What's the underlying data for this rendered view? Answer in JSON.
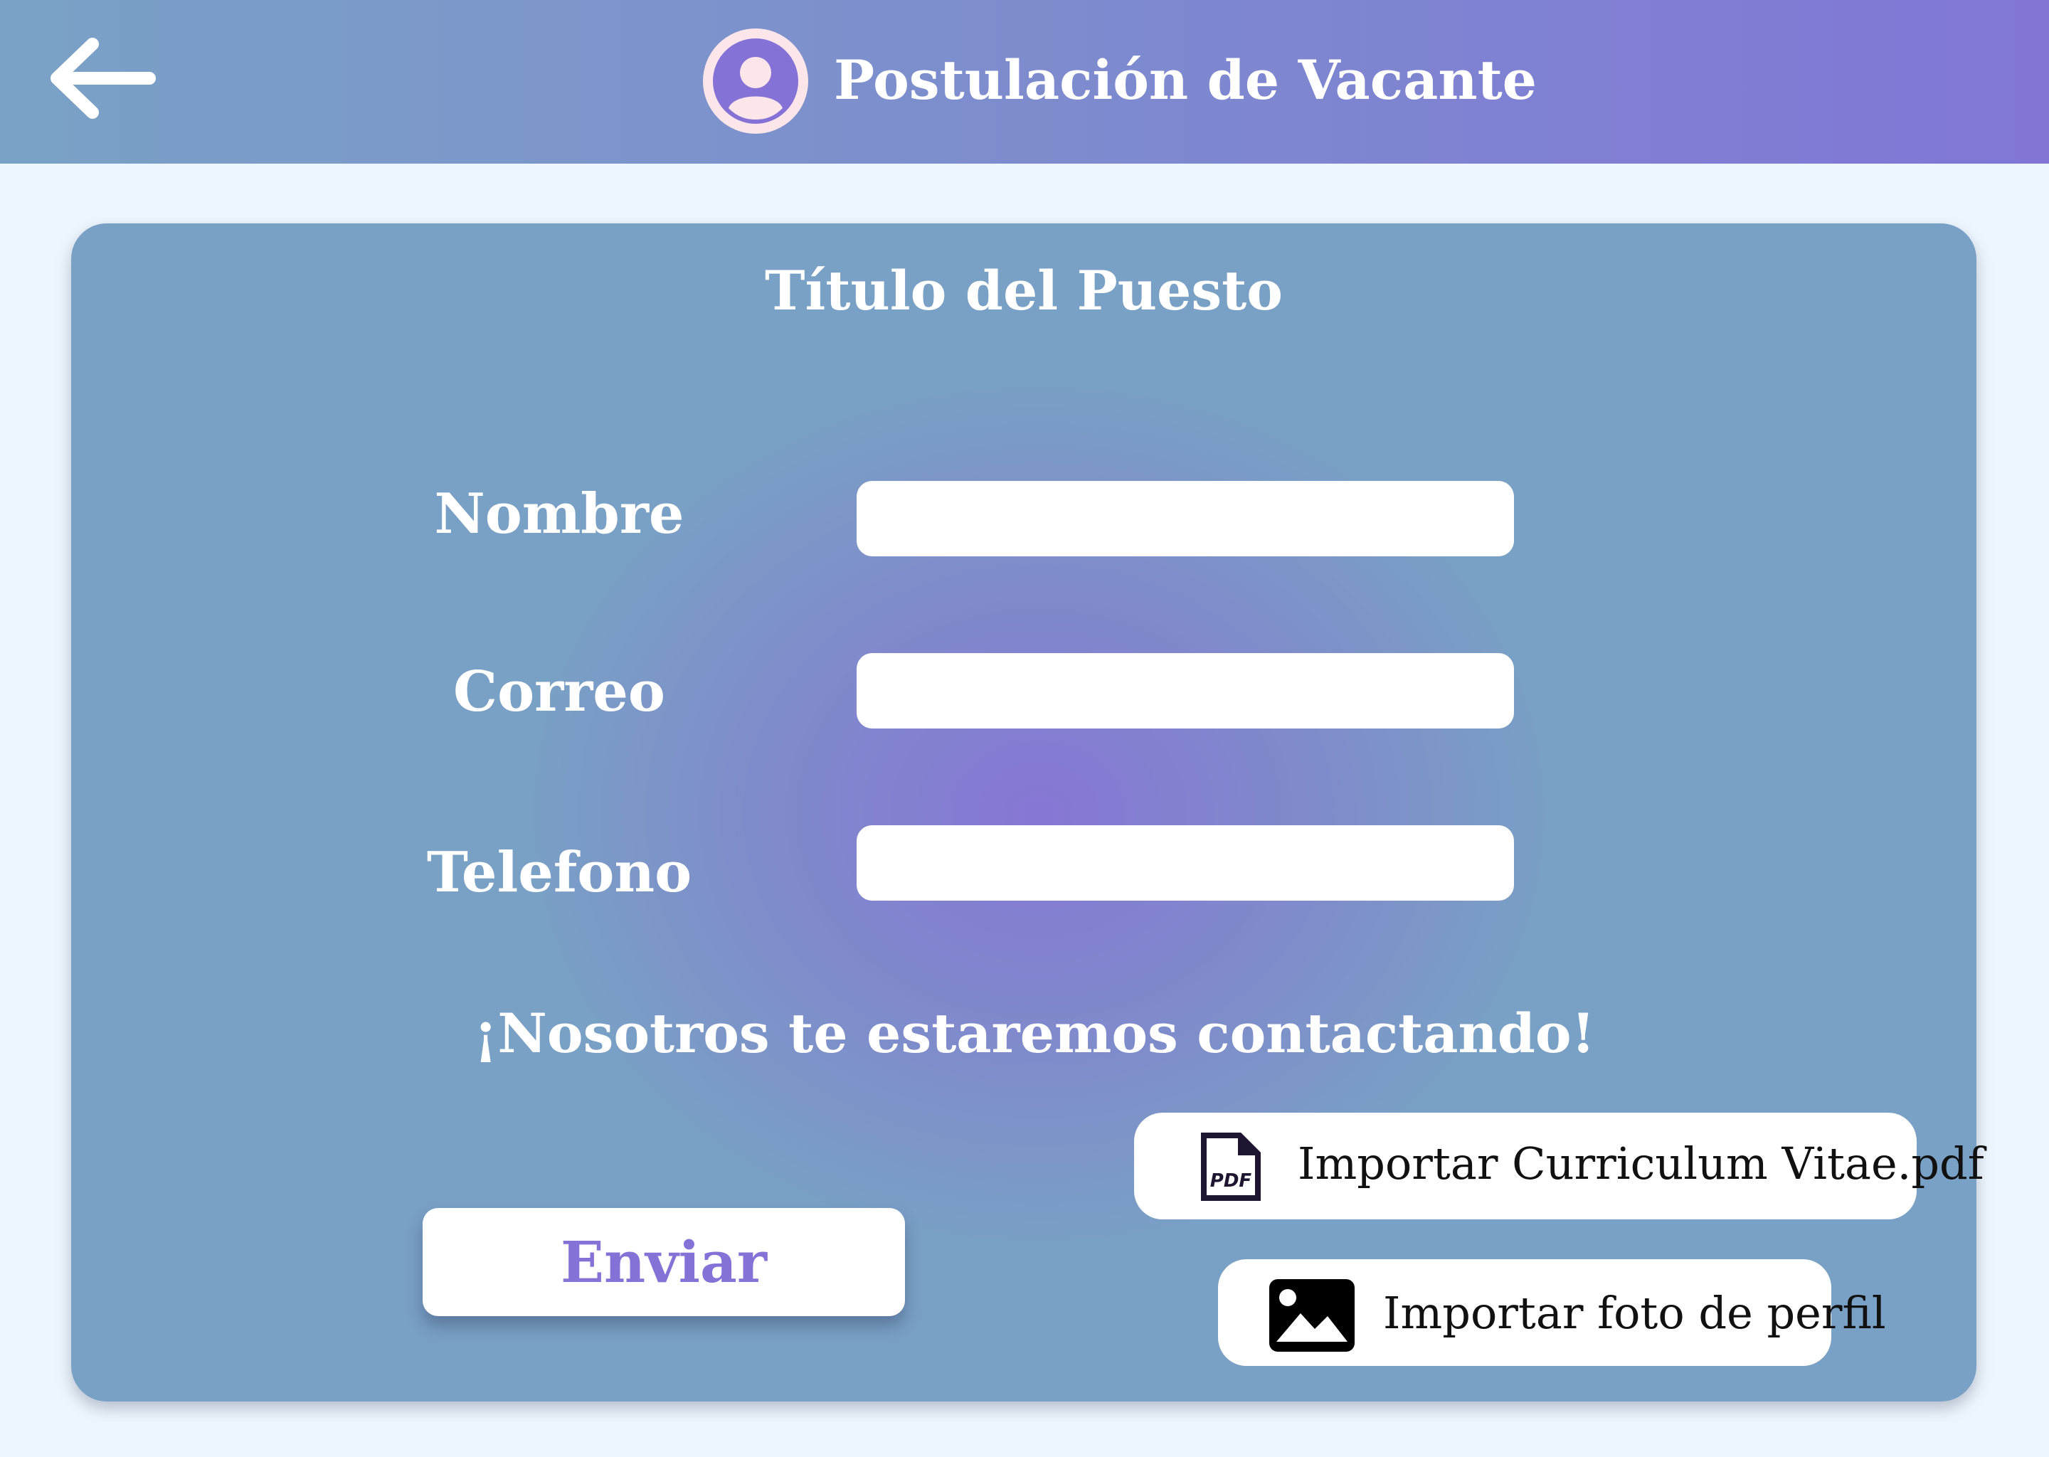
{
  "header": {
    "back_icon": "arrow-left-icon",
    "avatar_icon": "user-avatar-icon",
    "title": "Postulación de Vacante"
  },
  "form": {
    "title": "Título del Puesto",
    "fields": [
      {
        "label": "Nombre",
        "value": ""
      },
      {
        "label": "Correo",
        "value": ""
      },
      {
        "label": "Telefono",
        "value": ""
      }
    ],
    "message": "¡Nosotros te estaremos contactando!",
    "send_label": "Enviar",
    "import_cv_label": "Importar Curriculum Vitae.pdf",
    "import_cv_icon": "pdf-file-icon",
    "import_photo_label": "Importar foto de perfil",
    "import_photo_icon": "image-icon"
  },
  "colors": {
    "header_start": "#7aa2c6",
    "header_end": "#8176d6",
    "accent": "#8472d6",
    "background": "#eef6fd"
  }
}
